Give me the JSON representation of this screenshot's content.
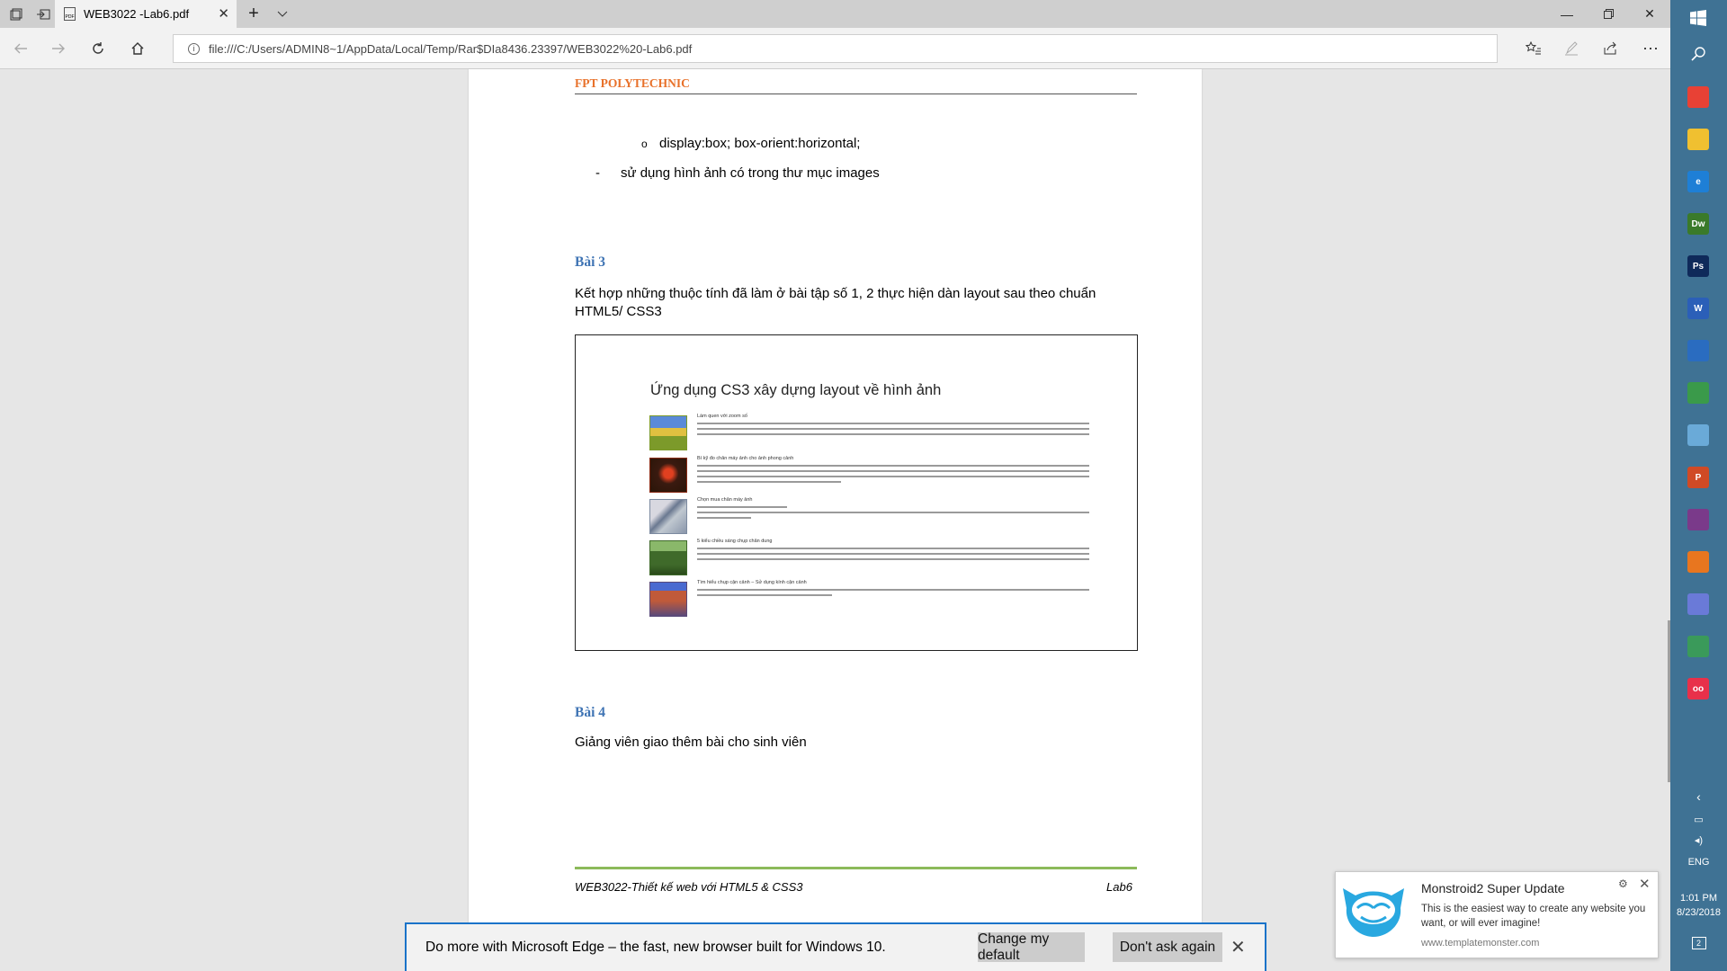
{
  "browser": {
    "tab_title": "WEB3022 -Lab6.pdf",
    "address": "file:///C:/Users/ADMIN8~1/AppData/Local/Temp/Rar$DIa8436.23397/WEB3022%20-Lab6.pdf"
  },
  "document": {
    "brand": "FPT POLYTECHNIC",
    "bullet_sub": "display:box; box-orient:horizontal;",
    "bullet_sub_marker": "o",
    "bullet_main": "sử dụng hình ảnh có trong thư mục images",
    "bullet_main_marker": "-",
    "bai3_heading": "Bài 3",
    "bai3_text": "Kết hợp những thuộc tính đã làm ở bài tập số 1, 2 thực hiện dàn layout sau theo chuẩn HTML5/ CSS3",
    "figure": {
      "title": "Ứng dụng CS3 xây dựng layout về hình ảnh",
      "items": [
        {
          "heading": "Làm quen với zoom số",
          "thumb": "#7c9a2a"
        },
        {
          "heading": "Bí kỹ đo chân máy ảnh cho ảnh phong cảnh",
          "thumb": "#8a2a14"
        },
        {
          "heading": "Chọn mua chân máy ảnh",
          "thumb": "#7c8aa0"
        },
        {
          "heading": "5 kiểu chiều sáng chụp chân dung",
          "thumb": "#3f6a2a"
        },
        {
          "heading": "Tìm hiểu chụp cận cảnh – Sử dụng kính cận cảnh",
          "thumb": "#5a4a7a"
        }
      ]
    },
    "bai4_heading": "Bài 4",
    "bai4_text": "Giảng viên giao thêm bài cho sinh viên",
    "footer_left": "WEB3022-Thiết kế web với HTML5 & CSS3",
    "footer_right": "Lab6"
  },
  "edge_bar": {
    "message": "Do more with Microsoft Edge – the fast, new browser built for Windows 10.",
    "change_default": "Change my default",
    "dont_ask": "Don't ask again"
  },
  "notification": {
    "title": "Monstroid2 Super Update",
    "body": "This is the easiest way to create any website you want, or will ever imagine!",
    "url": "www.templatemonster.com"
  },
  "taskbar": {
    "apps": [
      {
        "name": "chrome",
        "label": "",
        "color": "#e84135"
      },
      {
        "name": "file-explorer",
        "label": "",
        "color": "#f0c030"
      },
      {
        "name": "edge",
        "label": "e",
        "color": "#1e7fd6"
      },
      {
        "name": "dreamweaver",
        "label": "Dw",
        "color": "#3a7a2a"
      },
      {
        "name": "photoshop",
        "label": "Ps",
        "color": "#0f2a5a"
      },
      {
        "name": "word",
        "label": "W",
        "color": "#2b5fb8"
      },
      {
        "name": "virtualbox",
        "label": "",
        "color": "#2a6cc0"
      },
      {
        "name": "app-colorful",
        "label": "",
        "color": "#3a9a4a"
      },
      {
        "name": "app-people",
        "label": "",
        "color": "#6aaad8"
      },
      {
        "name": "powerpoint",
        "label": "P",
        "color": "#d04a25"
      },
      {
        "name": "winrar",
        "label": "",
        "color": "#7a3a8a"
      },
      {
        "name": "firefox",
        "label": "",
        "color": "#e8761f"
      },
      {
        "name": "discord",
        "label": "",
        "color": "#6a7ad8"
      },
      {
        "name": "android-studio",
        "label": "",
        "color": "#3a9a5a"
      },
      {
        "name": "flickr-app",
        "label": "oo",
        "color": "#e8304a"
      }
    ],
    "lang": "ENG",
    "time": "1:01 PM",
    "date": "8/23/2018",
    "notif_count": "2"
  }
}
